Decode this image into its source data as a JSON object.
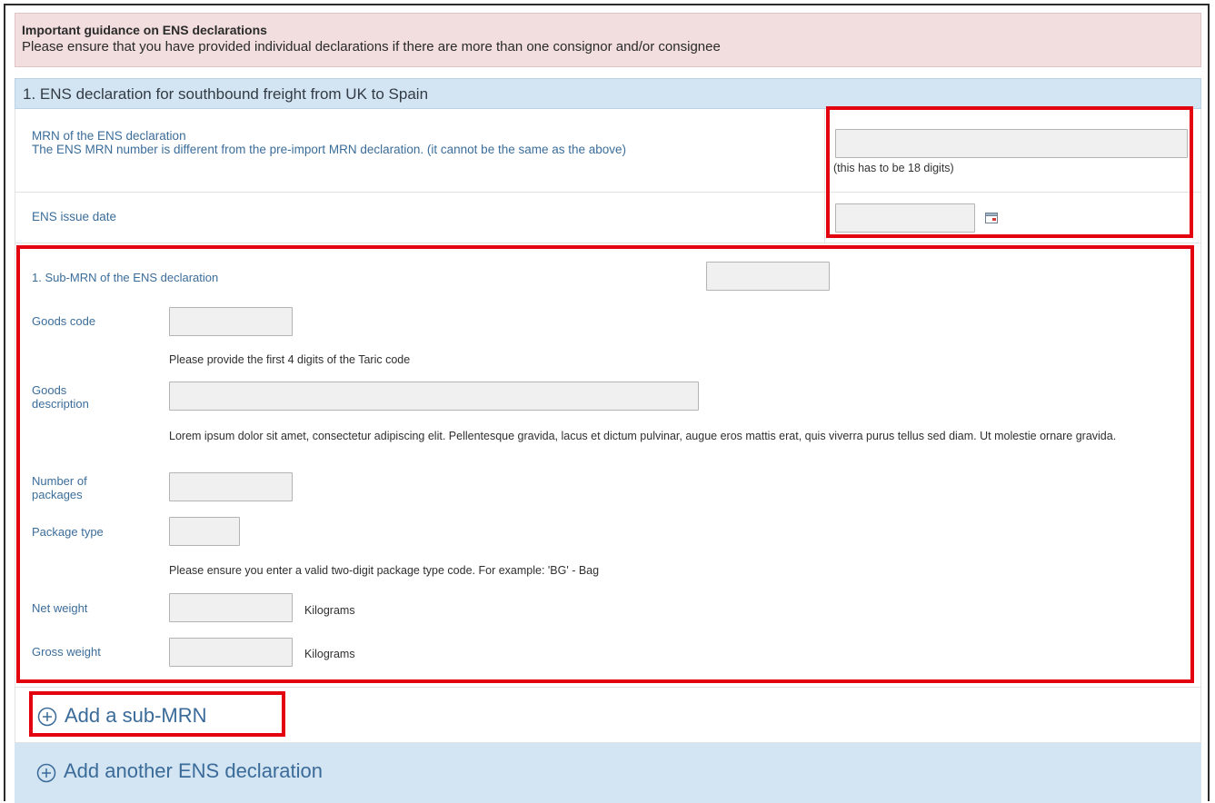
{
  "guidance": {
    "title": "Important guidance on ENS declarations",
    "text": "Please ensure that you have provided individual declarations if there are more than one consignor and/or consignee"
  },
  "section": {
    "title": "1. ENS declaration for southbound freight from UK to Spain"
  },
  "mrn": {
    "label_line1": "MRN of the ENS declaration",
    "label_line2": "The ENS MRN number is different from the pre-import MRN declaration. (it cannot be the same as the above)",
    "value": "",
    "helper": "(this has to be 18 digits)"
  },
  "issue_date": {
    "label": "ENS issue date",
    "value": "",
    "icon": "calendar-icon"
  },
  "sub_mrn": {
    "label": "1. Sub-MRN of the ENS declaration",
    "value": "",
    "goods_code_label": "Goods code",
    "goods_code_value": "",
    "goods_code_note": "Please provide the first 4 digits of the Taric code",
    "goods_description_label": "Goods description",
    "goods_description_value": "",
    "goods_description_note": "Lorem ipsum dolor sit amet, consectetur adipiscing elit. Pellentesque gravida, lacus et dictum pulvinar, augue eros mattis erat, quis viverra purus tellus sed diam. Ut molestie ornare gravida.",
    "packages_label": "Number of packages",
    "packages_value": "",
    "package_type_label": "Package type",
    "package_type_value": "",
    "package_type_note": "Please ensure you enter a valid two-digit package type code. For example: 'BG' - Bag",
    "net_weight_label": "Net weight",
    "net_weight_value": "",
    "net_weight_unit": "Kilograms",
    "gross_weight_label": "Gross weight",
    "gross_weight_value": "",
    "gross_weight_unit": "Kilograms"
  },
  "actions": {
    "add_sub_mrn": "Add a sub-MRN",
    "add_another_ens": "Add another ENS declaration",
    "icon": "plus-circle-icon"
  },
  "colors": {
    "highlight": "#e3000f",
    "label_blue": "#3b6d9a",
    "header_bg": "#d3e4f2",
    "guidance_bg": "#f2dede"
  }
}
